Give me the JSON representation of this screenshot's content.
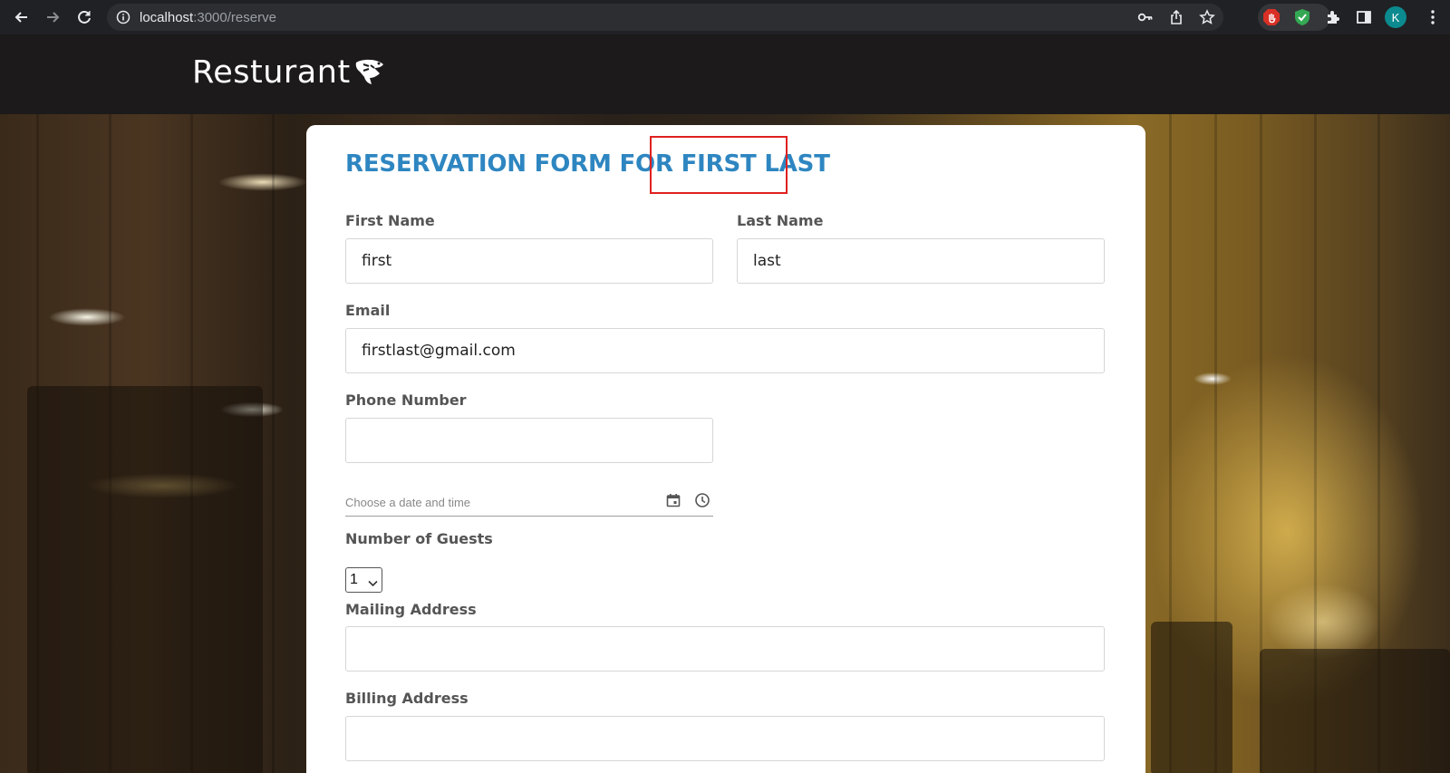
{
  "browser": {
    "url_host": "localhost",
    "url_path": ":3000/reserve",
    "profile_initial": "K",
    "icons": [
      "back-arrow-icon",
      "forward-arrow-icon",
      "reload-icon",
      "info-icon",
      "key-icon",
      "share-icon",
      "star-icon",
      "stop-hand-icon",
      "shield-check-icon",
      "puzzle-icon",
      "side-panel-icon",
      "more-vert-icon"
    ]
  },
  "header": {
    "logo_text": "Resturant"
  },
  "form": {
    "title_prefix": "RESERVATION FORM FOR ",
    "title_name": "FIRST LAST",
    "first_name_label": "First Name",
    "first_name_value": "first",
    "last_name_label": "Last Name",
    "last_name_value": "last",
    "email_label": "Email",
    "email_value": "firstlast@gmail.com",
    "phone_label": "Phone Number",
    "phone_value": "",
    "datetime_placeholder": "Choose a date and time",
    "guests_label": "Number of Guests",
    "guests_value": "1",
    "mailing_label": "Mailing Address",
    "mailing_value": "",
    "billing_label": "Billing Address",
    "billing_value": ""
  },
  "colors": {
    "title": "#2e86c1",
    "highlight_box": "#e02020",
    "header_bg": "#1c1a1a"
  }
}
